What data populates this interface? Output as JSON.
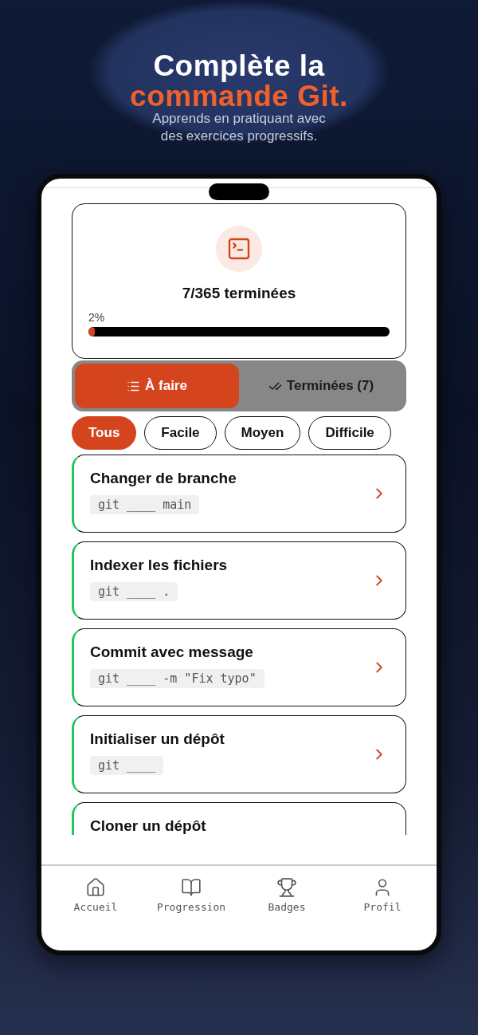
{
  "headline": {
    "line_1": "Complète la",
    "line_2": "commande Git.",
    "subtitle": "Apprends en pratiquant avec\ndes exercices progressifs."
  },
  "progress": {
    "summary": "7/365 terminées",
    "percent": "2%",
    "level": 0.02
  },
  "tabs": [
    {
      "label": "À faire",
      "kind": "list",
      "selected": true
    },
    {
      "label": "Terminées (7)",
      "kind": "done",
      "selected": false
    }
  ],
  "filters": [
    {
      "label": "Tous",
      "selected": true
    },
    {
      "label": "Facile",
      "selected": false
    },
    {
      "label": "Moyen",
      "selected": false
    },
    {
      "label": "Difficile",
      "selected": false
    }
  ],
  "exercises": [
    {
      "title": "Changer de branche",
      "command": "git ____ main"
    },
    {
      "title": "Indexer les fichiers",
      "command": "git ____ ."
    },
    {
      "title": "Commit avec message",
      "command": "git ____ -m \"Fix typo\""
    },
    {
      "title": "Initialiser un dépôt",
      "command": "git ____"
    },
    {
      "title": "Cloner un dépôt"
    }
  ],
  "bottom_nav": [
    {
      "label": "Accueil",
      "kind": "home"
    },
    {
      "label": "Progression",
      "kind": "book"
    },
    {
      "label": "Badges",
      "kind": "trophy"
    },
    {
      "label": "Profil",
      "kind": "user"
    }
  ]
}
